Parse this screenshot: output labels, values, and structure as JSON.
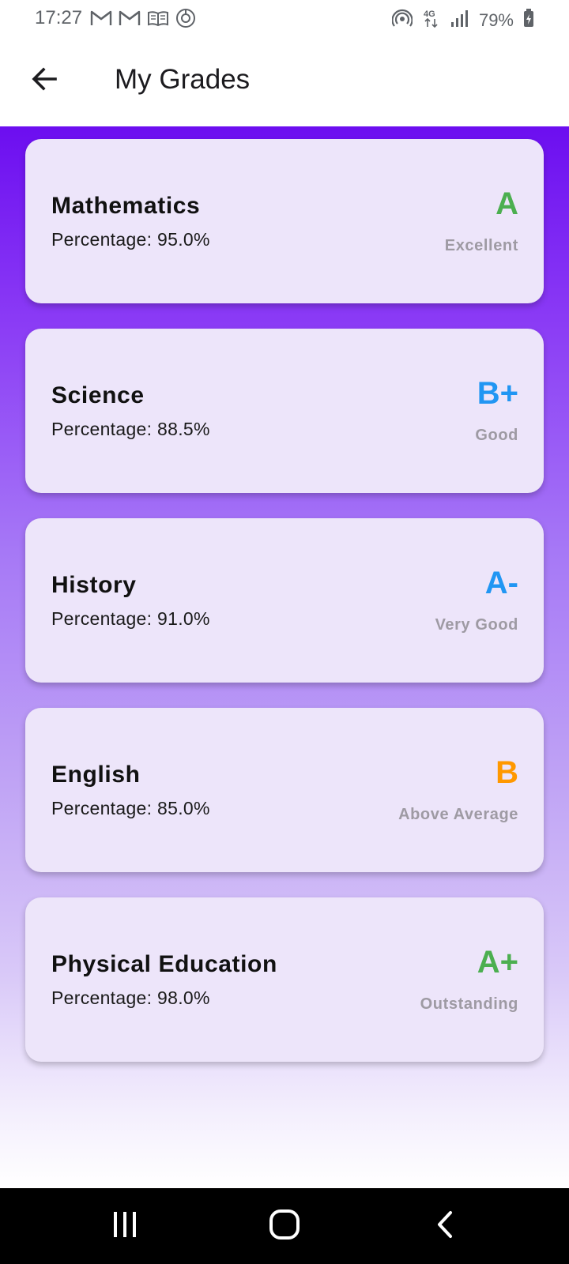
{
  "status_bar": {
    "time": "17:27",
    "battery": "79%",
    "left_icons": [
      "gmail-icon",
      "gmail-icon",
      "book-icon",
      "sync-icon"
    ],
    "right_icons": [
      "hotspot-icon",
      "data-4g-icon",
      "signal-icon",
      "battery-icon"
    ]
  },
  "app_bar": {
    "title": "My Grades",
    "back_icon": "arrow-left-icon"
  },
  "grades": [
    {
      "subject": "Mathematics",
      "percentage": "Percentage: 95.0%",
      "grade": "A",
      "description": "Excellent",
      "color": "#4caf50"
    },
    {
      "subject": "Science",
      "percentage": "Percentage: 88.5%",
      "grade": "B+",
      "description": "Good",
      "color": "#2196f3"
    },
    {
      "subject": "History",
      "percentage": "Percentage: 91.0%",
      "grade": "A-",
      "description": "Very Good",
      "color": "#2196f3"
    },
    {
      "subject": "English",
      "percentage": "Percentage: 85.0%",
      "grade": "B",
      "description": "Above Average",
      "color": "#ff9800"
    },
    {
      "subject": "Physical Education",
      "percentage": "Percentage: 98.0%",
      "grade": "A+",
      "description": "Outstanding",
      "color": "#4caf50"
    }
  ],
  "colors": {
    "gradient_top": "#6c0ef0",
    "card_background": "#ede5fa",
    "description_text": "#9e9aa3"
  },
  "nav_bar": {
    "buttons": [
      "recents-icon",
      "home-icon",
      "back-icon"
    ]
  }
}
